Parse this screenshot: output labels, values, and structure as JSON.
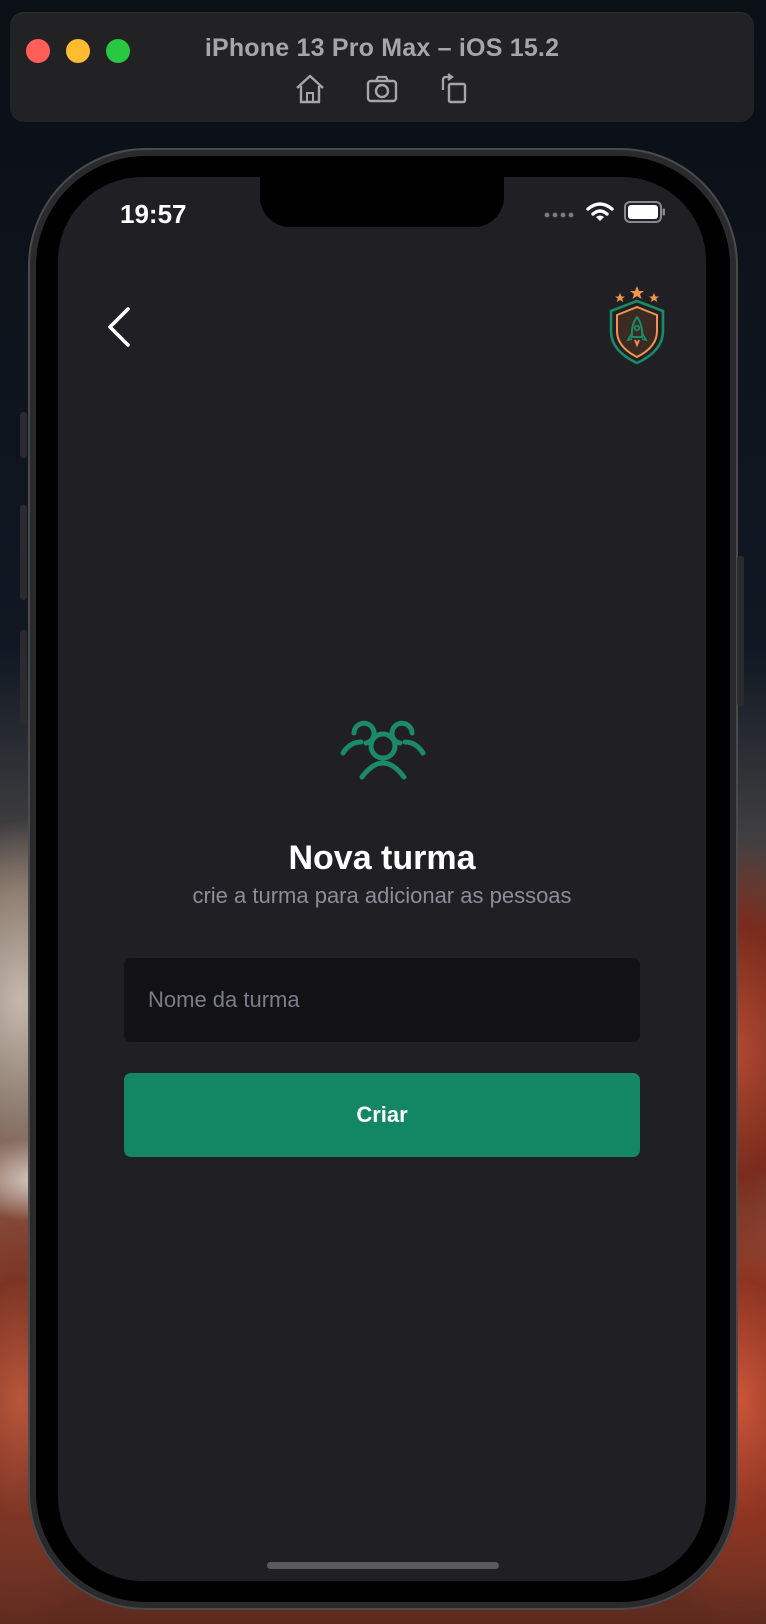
{
  "simulator": {
    "title": "iPhone 13 Pro Max – iOS 15.2",
    "tools": [
      "home-icon",
      "screenshot-icon",
      "rotate-icon"
    ]
  },
  "status_bar": {
    "time": "19:57",
    "icons": [
      "signal-dots-icon",
      "wifi-icon",
      "battery-icon"
    ]
  },
  "header": {
    "back_icon": "chevron-left-icon",
    "logo": "shield-rocket-logo"
  },
  "content": {
    "icon": "users-three-icon",
    "title": "Nova turma",
    "subtitle": "crie a turma para adicionar as pessoas",
    "input": {
      "placeholder": "Nome da turma",
      "value": ""
    },
    "button_label": "Criar"
  },
  "colors": {
    "background": "#202024",
    "input_background": "#121214",
    "accent": "#138664",
    "icon_green": "#1B8A66",
    "logo_orange": "#F0954B"
  }
}
